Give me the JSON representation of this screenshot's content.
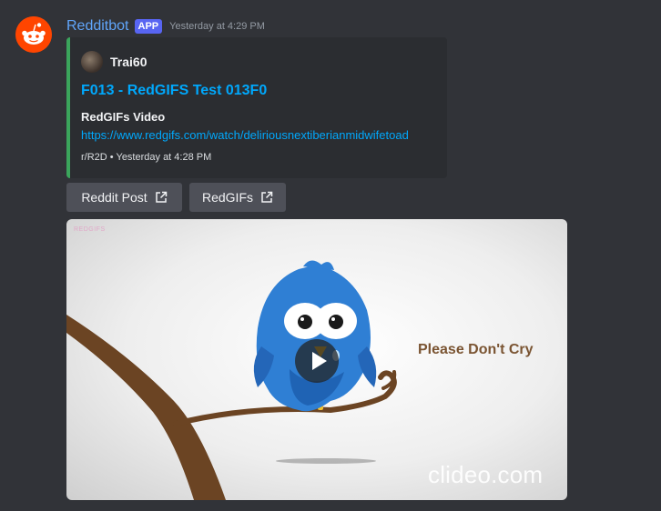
{
  "message": {
    "author": "Redditbot",
    "badge": "APP",
    "timestamp": "Yesterday at 4:29 PM",
    "avatar_color": "#ff4500"
  },
  "embed": {
    "author_name": "Trai60",
    "title": "F013 - RedGIFS Test 013F0",
    "field_name": "RedGIFs Video",
    "field_value": "https://www.redgifs.com/watch/deliriousnextiberianmidwifetoad",
    "footer": "r/R2D • Yesterday at 4:28 PM",
    "accent_color": "#3ba55c"
  },
  "buttons": [
    {
      "label": "Reddit Post",
      "icon": "external-link-icon"
    },
    {
      "label": "RedGIFs",
      "icon": "external-link-icon"
    }
  ],
  "media": {
    "top_watermark": "REDGIFS",
    "caption": "Please Don't Cry",
    "watermark": "clideo.com",
    "play_icon": "play-icon"
  }
}
